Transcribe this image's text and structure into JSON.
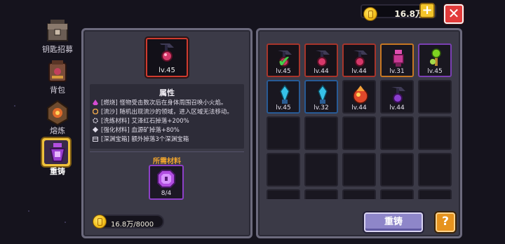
{
  "top_bar": {
    "gold": "16.8万",
    "add_symbol": "+",
    "close_symbol": "✕"
  },
  "nav": {
    "items": [
      {
        "label": "钥匙招募",
        "icon": "chest-icon"
      },
      {
        "label": "背包",
        "icon": "backpack-icon"
      },
      {
        "label": "熔炼",
        "icon": "smelt-icon"
      },
      {
        "label": "重铸",
        "icon": "reforge-icon",
        "active": true
      }
    ]
  },
  "detail": {
    "selected_item": {
      "level": "lv.45",
      "icon": "dark-scythe-relic-icon",
      "color": "#cf3b2f"
    },
    "attributes_title": "属性",
    "attributes": [
      {
        "icon": "flame-icon",
        "color": "#d64bd1",
        "text": "[燃烧] 怪物受击数次后在身体周围召唤小火焰。"
      },
      {
        "icon": "swirl-icon",
        "color": "#e9a54b",
        "text": "[流沙] 随机出现流沙的领域，进入区域无法移动。"
      },
      {
        "icon": "gear-icon",
        "color": "#e0dce8",
        "text": "[洗练材料] 艾泽红石掉落+200%"
      },
      {
        "icon": "diamond-icon",
        "color": "#e0dce8",
        "text": "[强化材料] 血源矿掉落+80%"
      },
      {
        "icon": "box-icon",
        "color": "#e0dce8",
        "text": "[深渊宝箱] 额外掉落3个深渊宝箱"
      }
    ],
    "materials_title": "所需材料",
    "material": {
      "icon": "purple-gem-icon",
      "count": "8/4"
    },
    "cost": "16.8万/8000"
  },
  "inventory": {
    "slots": [
      {
        "level": "lv.45",
        "rarity": "red",
        "icon": "dark-scythe-icon",
        "equipped": true
      },
      {
        "level": "lv.44",
        "rarity": "red",
        "icon": "dark-scythe-icon"
      },
      {
        "level": "lv.44",
        "rarity": "red",
        "icon": "dark-scythe-icon"
      },
      {
        "level": "lv.31",
        "rarity": "orange",
        "icon": "pink-totem-icon"
      },
      {
        "level": "lv.45",
        "rarity": "purple",
        "icon": "green-staff-icon"
      },
      {
        "level": "lv.45",
        "rarity": "blue",
        "icon": "blue-crystal-icon"
      },
      {
        "level": "lv.32",
        "rarity": "blue",
        "icon": "blue-crystal-icon"
      },
      {
        "level": "lv.44",
        "rarity": "empty",
        "icon": "fire-orb-icon"
      },
      {
        "level": "lv.44",
        "rarity": "empty",
        "icon": "dark-scythe-icon"
      }
    ],
    "reforge_button": "重铸",
    "help_button": "?"
  }
}
